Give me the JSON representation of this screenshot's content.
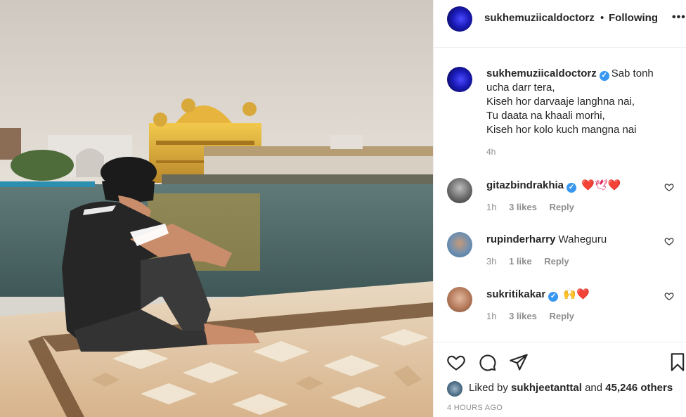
{
  "post": {
    "header": {
      "username": "sukhemuziicaldoctorz",
      "separator": "•",
      "follow_status": "Following",
      "more_label": "•••"
    },
    "caption": {
      "username": "sukhemuziicaldoctorz",
      "lines": [
        "Sab tonh",
        "ucha darr tera,",
        "Kiseh hor darvaaje langhna nai,",
        "Tu daata na khaali morhi,",
        "Kiseh hor kolo kuch mangna nai"
      ],
      "time": "4h"
    },
    "comments": [
      {
        "username": "gitazbindrakhia",
        "verified": true,
        "text": "❤️🕊❤️",
        "time": "1h",
        "likes": "3 likes",
        "reply": "Reply"
      },
      {
        "username": "rupinderharry",
        "verified": false,
        "text": "Waheguru",
        "time": "3h",
        "likes": "1 like",
        "reply": "Reply"
      },
      {
        "username": "sukritikakar",
        "verified": true,
        "text": "🙌❤️",
        "time": "1h",
        "likes": "3 likes",
        "reply": "Reply"
      }
    ],
    "likes": {
      "prefix": "Liked by",
      "user": "sukhjeetanttal",
      "conj": "and",
      "others": "45,246 others"
    },
    "posted": "4 HOURS AGO"
  },
  "icons": {
    "like": "heart-icon",
    "comment": "comment-icon",
    "share": "send-icon",
    "save": "bookmark-icon",
    "verified": "verified-badge-icon"
  },
  "colors": {
    "text": "#262626",
    "secondary": "#8e8e8e",
    "verified": "#3897f0",
    "heart": "#e0245e",
    "divider": "#efefef"
  }
}
